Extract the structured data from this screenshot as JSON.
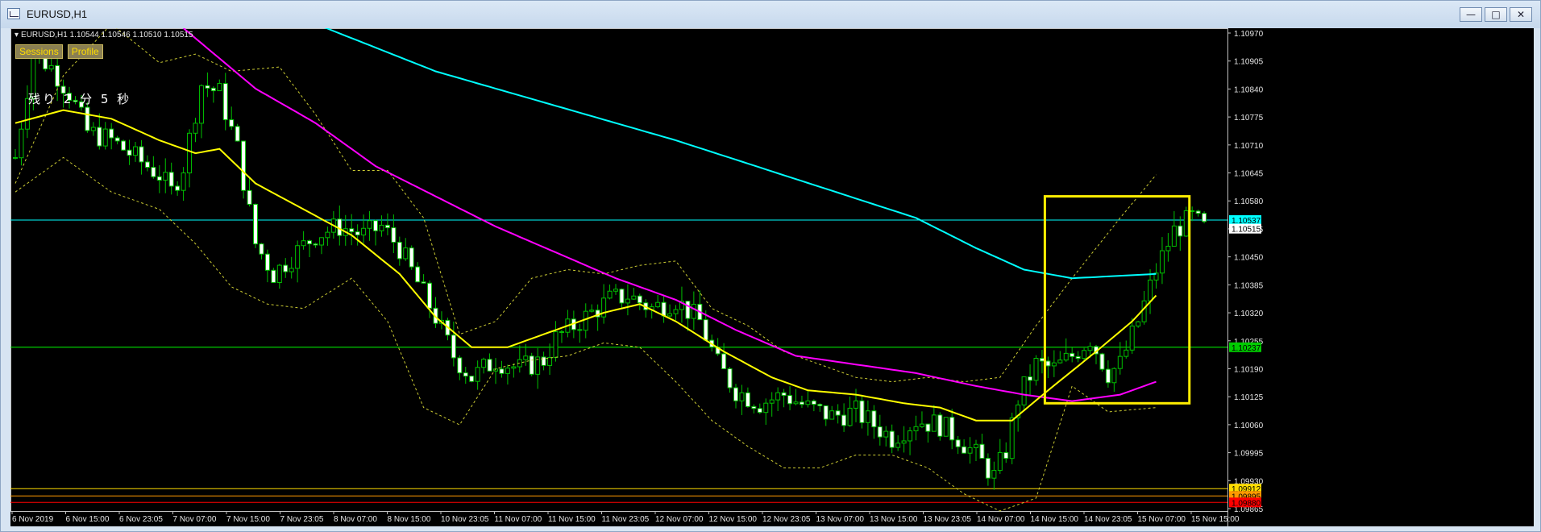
{
  "window": {
    "title": "EURUSD,H1",
    "buttons": {
      "minimize": "—",
      "maximize": "□",
      "close": "✕"
    }
  },
  "chart_header": {
    "symbol_line": "EURUSD,H1  1.10544 1.10546 1.10510 1.10515",
    "buttons": [
      "Sessions",
      "Profile"
    ],
    "timer": "残り 2 分 5 秒"
  },
  "colors": {
    "background": "#000000",
    "bull_candle": "#00c000",
    "bear_candle": "#ffffff",
    "ma_fast": "#ffff00",
    "ma_mid": "#ff00ff",
    "ma_slow": "#00ffff",
    "bands": "#cccc33",
    "highlight_box": "#ffee00",
    "hline_cyan": "#00ffff",
    "hline_green": "#00ff00",
    "axis_text": "#e6e6e6"
  },
  "chart_data": {
    "type": "candlestick",
    "y_ticks": [
      "1.10970",
      "1.10905",
      "1.10840",
      "1.10775",
      "1.10710",
      "1.10645",
      "1.10580",
      "1.10515",
      "1.10450",
      "1.10385",
      "1.10320",
      "1.10255",
      "1.10190",
      "1.10125",
      "1.10060",
      "1.09995",
      "1.09930",
      "1.09865"
    ],
    "ylim": [
      1.0986,
      1.1098
    ],
    "x_ticks": [
      "6 Nov 2019",
      "6 Nov 15:00",
      "6 Nov 23:05",
      "7 Nov 07:00",
      "7 Nov 15:00",
      "7 Nov 23:05",
      "8 Nov 07:00",
      "8 Nov 15:00",
      "10 Nov 23:05",
      "11 Nov 07:00",
      "11 Nov 15:00",
      "11 Nov 23:05",
      "12 Nov 07:00",
      "12 Nov 15:00",
      "12 Nov 23:05",
      "13 Nov 07:00",
      "13 Nov 15:00",
      "13 Nov 23:05",
      "14 Nov 07:00",
      "14 Nov 15:00",
      "14 Nov 23:05",
      "15 Nov 07:00",
      "15 Nov 15:00"
    ],
    "price_labels": [
      {
        "text": "1.10537",
        "price": 1.10535,
        "bg": "#00ffff",
        "fg": "#000000"
      },
      {
        "text": "1.10515",
        "price": 1.10515,
        "bg": "#ffffff",
        "fg": "#000000"
      },
      {
        "text": "1.10237",
        "price": 1.1024,
        "bg": "#00cc00",
        "fg": "#000000"
      },
      {
        "text": "1.09912",
        "price": 1.09912,
        "bg": "#ffdd00",
        "fg": "#000000"
      },
      {
        "text": "1.09895",
        "price": 1.09895,
        "bg": "#ff9900",
        "fg": "#000000"
      },
      {
        "text": "1.09880",
        "price": 1.0988,
        "bg": "#ff0000",
        "fg": "#000000"
      }
    ],
    "hlines": [
      {
        "price": 1.10535,
        "color": "#00ffff"
      },
      {
        "price": 1.1024,
        "color": "#00ff00"
      },
      {
        "price": 1.09912,
        "color": "#ffdd00"
      },
      {
        "price": 1.09895,
        "color": "#ff9900"
      },
      {
        "price": 1.0988,
        "color": "#ff0000"
      }
    ],
    "highlight_box": {
      "bar_start": 172,
      "bar_end": 195,
      "price_top": 1.1059,
      "price_bottom": 1.1011
    },
    "ma_fast": [
      [
        0,
        1.1076
      ],
      [
        8,
        1.1079
      ],
      [
        16,
        1.1077
      ],
      [
        24,
        1.1072
      ],
      [
        30,
        1.1069
      ],
      [
        34,
        1.107
      ],
      [
        40,
        1.1062
      ],
      [
        48,
        1.1056
      ],
      [
        56,
        1.105
      ],
      [
        64,
        1.1041
      ],
      [
        70,
        1.1031
      ],
      [
        76,
        1.1024
      ],
      [
        82,
        1.1024
      ],
      [
        90,
        1.1028
      ],
      [
        98,
        1.1032
      ],
      [
        104,
        1.1034
      ],
      [
        110,
        1.103
      ],
      [
        118,
        1.1023
      ],
      [
        126,
        1.1017
      ],
      [
        132,
        1.1014
      ],
      [
        140,
        1.1013
      ],
      [
        148,
        1.1011
      ],
      [
        154,
        1.101
      ],
      [
        160,
        1.1007
      ],
      [
        166,
        1.1007
      ],
      [
        172,
        1.1014
      ],
      [
        180,
        1.1023
      ],
      [
        186,
        1.103
      ],
      [
        190,
        1.1036
      ]
    ],
    "ma_mid": [
      [
        28,
        1.1098
      ],
      [
        40,
        1.1084
      ],
      [
        50,
        1.1076
      ],
      [
        60,
        1.1066
      ],
      [
        70,
        1.1059
      ],
      [
        80,
        1.1052
      ],
      [
        90,
        1.1046
      ],
      [
        100,
        1.104
      ],
      [
        110,
        1.1035
      ],
      [
        120,
        1.1028
      ],
      [
        130,
        1.1022
      ],
      [
        140,
        1.102
      ],
      [
        150,
        1.1018
      ],
      [
        160,
        1.1015
      ],
      [
        168,
        1.1013
      ],
      [
        176,
        1.10115
      ],
      [
        184,
        1.1013
      ],
      [
        190,
        1.1016
      ]
    ],
    "ma_slow": [
      [
        50,
        1.1099
      ],
      [
        70,
        1.1088
      ],
      [
        90,
        1.108
      ],
      [
        110,
        1.1072
      ],
      [
        130,
        1.1063
      ],
      [
        150,
        1.1054
      ],
      [
        160,
        1.1047
      ],
      [
        168,
        1.1042
      ],
      [
        176,
        1.104
      ],
      [
        190,
        1.1041
      ]
    ],
    "band_upper": [
      [
        0,
        1.1062
      ],
      [
        8,
        1.1087
      ],
      [
        16,
        1.1099
      ],
      [
        24,
        1.109
      ],
      [
        30,
        1.1092
      ],
      [
        36,
        1.1088
      ],
      [
        44,
        1.1089
      ],
      [
        50,
        1.1078
      ],
      [
        56,
        1.1065
      ],
      [
        62,
        1.1065
      ],
      [
        68,
        1.1054
      ],
      [
        74,
        1.1027
      ],
      [
        80,
        1.103
      ],
      [
        86,
        1.104
      ],
      [
        92,
        1.1042
      ],
      [
        98,
        1.1041
      ],
      [
        104,
        1.1043
      ],
      [
        110,
        1.1044
      ],
      [
        116,
        1.1033
      ],
      [
        122,
        1.1029
      ],
      [
        128,
        1.1023
      ],
      [
        134,
        1.102
      ],
      [
        140,
        1.1017
      ],
      [
        146,
        1.1016
      ],
      [
        152,
        1.1017
      ],
      [
        158,
        1.1016
      ],
      [
        164,
        1.1017
      ],
      [
        170,
        1.1029
      ],
      [
        176,
        1.104
      ],
      [
        184,
        1.1054
      ],
      [
        190,
        1.1064
      ]
    ],
    "band_lower": [
      [
        0,
        1.106
      ],
      [
        8,
        1.1068
      ],
      [
        16,
        1.106
      ],
      [
        24,
        1.1056
      ],
      [
        30,
        1.1048
      ],
      [
        36,
        1.1038
      ],
      [
        42,
        1.1034
      ],
      [
        48,
        1.1033
      ],
      [
        56,
        1.104
      ],
      [
        62,
        1.103
      ],
      [
        68,
        1.101
      ],
      [
        74,
        1.1006
      ],
      [
        80,
        1.1019
      ],
      [
        86,
        1.1021
      ],
      [
        92,
        1.1022
      ],
      [
        98,
        1.1025
      ],
      [
        104,
        1.1024
      ],
      [
        110,
        1.1016
      ],
      [
        116,
        1.1007
      ],
      [
        122,
        1.1001
      ],
      [
        128,
        1.0996
      ],
      [
        134,
        1.0996
      ],
      [
        140,
        1.0999
      ],
      [
        146,
        1.0999
      ],
      [
        152,
        1.0996
      ],
      [
        158,
        1.099
      ],
      [
        164,
        1.0986
      ],
      [
        170,
        1.0989
      ],
      [
        176,
        1.1015
      ],
      [
        182,
        1.1009
      ],
      [
        190,
        1.101
      ]
    ],
    "close_path": [
      [
        0,
        1.1068
      ],
      [
        3,
        1.1092
      ],
      [
        6,
        1.1089
      ],
      [
        9,
        1.1083
      ],
      [
        12,
        1.1074
      ],
      [
        16,
        1.1072
      ],
      [
        20,
        1.1068
      ],
      [
        24,
        1.1064
      ],
      [
        26,
        1.106
      ],
      [
        28,
        1.1066
      ],
      [
        31,
        1.1085
      ],
      [
        34,
        1.1083
      ],
      [
        37,
        1.107
      ],
      [
        40,
        1.1048
      ],
      [
        43,
        1.1041
      ],
      [
        46,
        1.1045
      ],
      [
        50,
        1.105
      ],
      [
        54,
        1.1052
      ],
      [
        58,
        1.105
      ],
      [
        61,
        1.1052
      ],
      [
        64,
        1.1047
      ],
      [
        67,
        1.1039
      ],
      [
        70,
        1.1031
      ],
      [
        73,
        1.1022
      ],
      [
        76,
        1.1017
      ],
      [
        80,
        1.1021
      ],
      [
        84,
        1.1019
      ],
      [
        88,
        1.1021
      ],
      [
        90,
        1.1026
      ],
      [
        93,
        1.1029
      ],
      [
        96,
        1.1032
      ],
      [
        99,
        1.1035
      ],
      [
        102,
        1.1036
      ],
      [
        106,
        1.1033
      ],
      [
        110,
        1.1035
      ],
      [
        114,
        1.103
      ],
      [
        117,
        1.102
      ],
      [
        120,
        1.1014
      ],
      [
        124,
        1.1011
      ],
      [
        128,
        1.1013
      ],
      [
        132,
        1.101
      ],
      [
        136,
        1.1008
      ],
      [
        140,
        1.1009
      ],
      [
        143,
        1.1006
      ],
      [
        146,
        1.1003
      ],
      [
        150,
        1.1007
      ],
      [
        154,
        1.1006
      ],
      [
        157,
        1.1003
      ],
      [
        160,
        1.0999
      ],
      [
        163,
        1.0994
      ],
      [
        165,
        1.1
      ],
      [
        167,
        1.1012
      ],
      [
        170,
        1.102
      ],
      [
        173,
        1.1019
      ],
      [
        176,
        1.1022
      ],
      [
        179,
        1.1026
      ],
      [
        182,
        1.1018
      ],
      [
        184,
        1.102
      ],
      [
        187,
        1.103
      ],
      [
        190,
        1.1042
      ],
      [
        193,
        1.1051
      ],
      [
        196,
        1.1054
      ],
      [
        198,
        1.10515
      ]
    ]
  }
}
